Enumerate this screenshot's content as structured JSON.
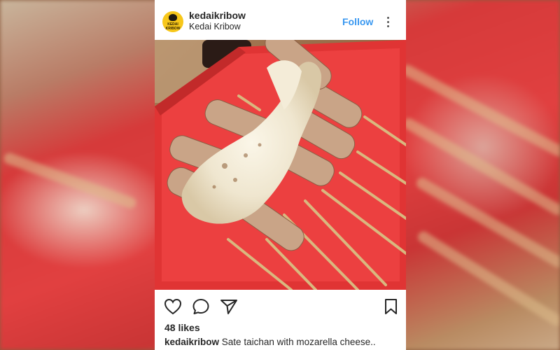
{
  "post": {
    "username": "kedaikribow",
    "location": "Kedai Kribow",
    "follow_label": "Follow",
    "likes": "48 likes",
    "caption_username": "kedaikribow",
    "caption_text": "Sate taichan with mozarella cheese..",
    "avatar_text": "KEDAI KRIBOW"
  },
  "icons": {
    "more": "more-vertical-icon",
    "like": "heart-icon",
    "comment": "comment-icon",
    "share": "send-icon",
    "save": "bookmark-icon"
  },
  "colors": {
    "follow": "#3897f0",
    "text": "#262626",
    "avatar": "#f7c71a"
  }
}
